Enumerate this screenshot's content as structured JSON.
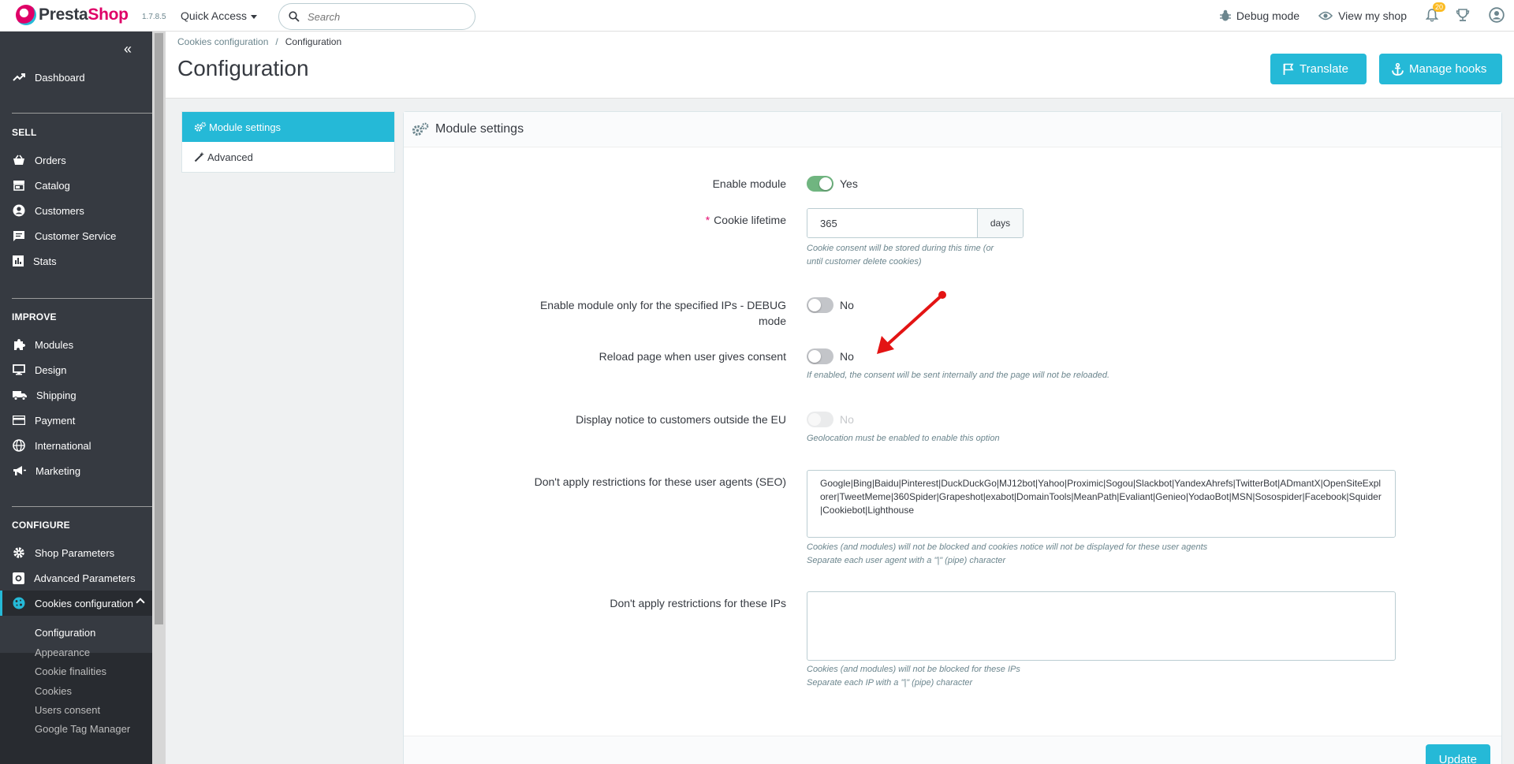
{
  "header": {
    "logo_prefix": "Presta",
    "logo_suffix": "Shop",
    "version": "1.7.8.5",
    "quick_access": "Quick Access",
    "search_placeholder": "Search",
    "debug_mode": "Debug mode",
    "view_shop": "View my shop",
    "notifications_count": "20"
  },
  "sidebar": {
    "dashboard": "Dashboard",
    "sell_title": "SELL",
    "sell_items": [
      "Orders",
      "Catalog",
      "Customers",
      "Customer Service",
      "Stats"
    ],
    "improve_title": "IMPROVE",
    "improve_items": [
      "Modules",
      "Design",
      "Shipping",
      "Payment",
      "International",
      "Marketing"
    ],
    "configure_title": "CONFIGURE",
    "configure_items": [
      "Shop Parameters",
      "Advanced Parameters",
      "Cookies configuration"
    ],
    "sub_items": [
      "Configuration",
      "Appearance",
      "Cookie finalities",
      "Cookies",
      "Users consent",
      "Google Tag Manager"
    ]
  },
  "page": {
    "breadcrumb_parent": "Cookies configuration",
    "breadcrumb_sep": "/",
    "breadcrumb_current": "Configuration",
    "title": "Configuration",
    "translate_button": "Translate",
    "manage_hooks_button": "Manage hooks"
  },
  "tabs": {
    "module_settings": "Module settings",
    "advanced": "Advanced"
  },
  "form": {
    "panel_title": "Module settings",
    "enable_module_label": "Enable module",
    "enable_module_value": "Yes",
    "cookie_lifetime_label": "Cookie lifetime",
    "cookie_lifetime_required": "*",
    "cookie_lifetime_value": "365",
    "cookie_lifetime_unit": "days",
    "cookie_lifetime_help_1": "Cookie consent will be stored during this time (or",
    "cookie_lifetime_help_2": "until customer delete cookies)",
    "debug_label_1": "Enable module only for the specified IPs - DEBUG",
    "debug_label_2": "mode",
    "debug_value": "No",
    "reload_label": "Reload page when user gives consent",
    "reload_value": "No",
    "reload_help": "If enabled, the consent will be sent internally and the page will not be reloaded.",
    "outside_eu_label": "Display notice to customers outside the EU",
    "outside_eu_value": "No",
    "outside_eu_help": "Geolocation must be enabled to enable this option",
    "user_agents_label": "Don't apply restrictions for these user agents (SEO)",
    "user_agents_value": "Google|Bing|Baidu|Pinterest|DuckDuckGo|MJ12bot|Yahoo|Proximic|Sogou|Slackbot|YandexAhrefs|TwitterBot|ADmantX|OpenSiteExplorer|TweetMeme|360Spider|Grapeshot|exabot|DomainTools|MeanPath|Evaliant|Genieo|YodaoBot|MSN|Sosospider|Facebook|Squider|Cookiebot|Lighthouse",
    "user_agents_help_1": "Cookies (and modules) will not be blocked and cookies notice will not be displayed for these user agents",
    "user_agents_help_2": "Separate each user agent with a \"|\" (pipe) character",
    "ips_label": "Don't apply restrictions for these IPs",
    "ips_value": "",
    "ips_help_1": "Cookies (and modules) will not be blocked for these IPs",
    "ips_help_2": "Separate each IP with a \"|\" (pipe) character",
    "update_button": "Update"
  },
  "colors": {
    "accent": "#25b9d7",
    "sidebar_bg": "#363a41",
    "toggle_on": "#70b580",
    "brand_pink": "#df0067",
    "annotation_arrow": "#e31414"
  }
}
